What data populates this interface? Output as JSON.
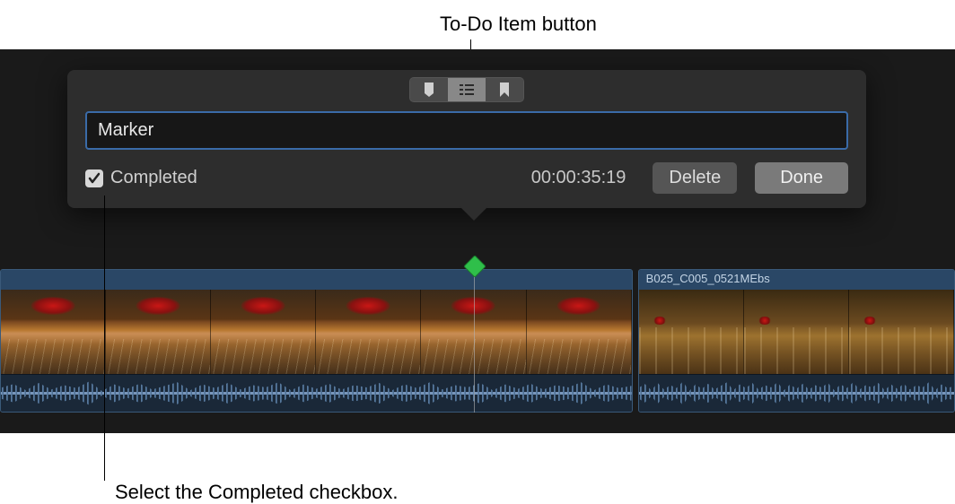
{
  "callouts": {
    "top": "To-Do Item button",
    "bottom": "Select the Completed checkbox."
  },
  "popover": {
    "marker_name": "Marker",
    "completed_label": "Completed",
    "completed_checked": true,
    "timecode": "00:00:35:19",
    "delete_label": "Delete",
    "done_label": "Done",
    "marker_types": {
      "standard": "standard-marker",
      "todo": "todo-marker",
      "chapter": "chapter-marker",
      "active": "todo"
    }
  },
  "timeline": {
    "clips": [
      {
        "name": ""
      },
      {
        "name": "B025_C005_0521MEbs"
      }
    ]
  }
}
